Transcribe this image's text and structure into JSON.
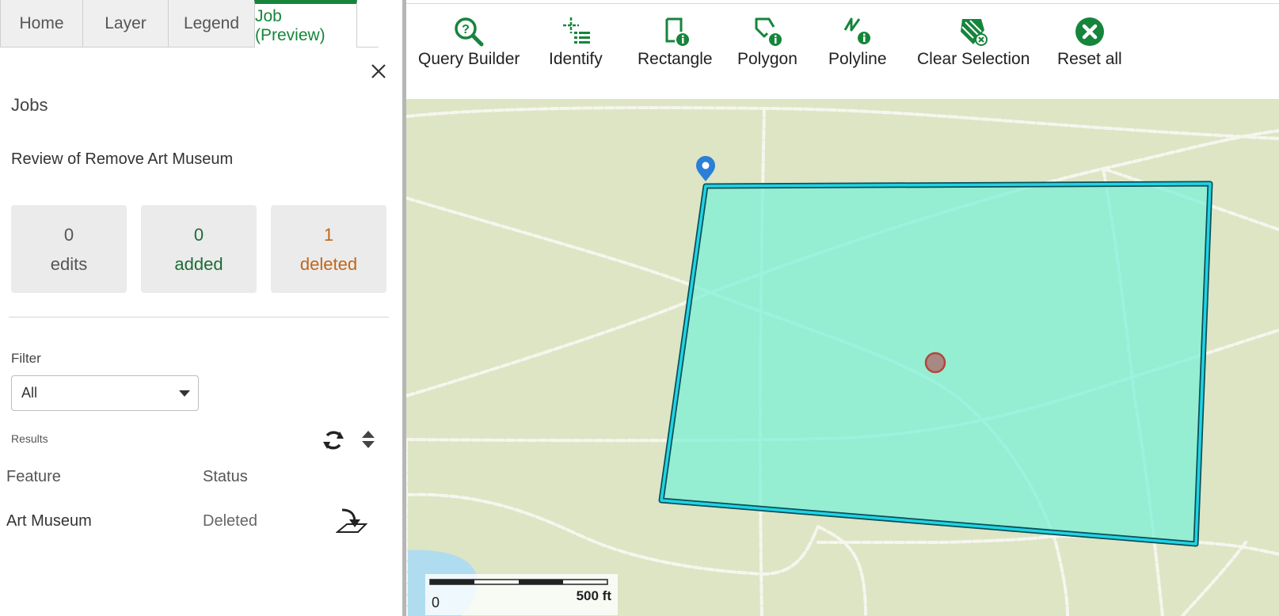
{
  "tabs": [
    {
      "label": "Home",
      "active": false
    },
    {
      "label": "Layer",
      "active": false
    },
    {
      "label": "Legend",
      "active": false
    },
    {
      "label": "Job (Preview)",
      "active": true
    }
  ],
  "panel": {
    "title": "Jobs",
    "job_title": "Review of Remove Art Museum",
    "stats": {
      "edits": {
        "value": "0",
        "label": "edits"
      },
      "added": {
        "value": "0",
        "label": "added"
      },
      "deleted": {
        "value": "1",
        "label": "deleted"
      }
    },
    "filter": {
      "label": "Filter",
      "value": "All"
    },
    "results": {
      "label": "Results",
      "columns": [
        "Feature",
        "Status"
      ],
      "rows": [
        {
          "feature": "Art Museum",
          "status": "Deleted"
        }
      ]
    }
  },
  "toolbar": {
    "items": [
      {
        "label": "Query Builder",
        "icon": "query-builder-icon"
      },
      {
        "label": "Identify",
        "icon": "identify-icon"
      },
      {
        "label": "Rectangle",
        "icon": "rectangle-select-icon"
      },
      {
        "label": "Polygon",
        "icon": "polygon-select-icon"
      },
      {
        "label": "Polyline",
        "icon": "polyline-select-icon"
      },
      {
        "label": "Clear Selection",
        "icon": "clear-selection-icon"
      },
      {
        "label": "Reset all",
        "icon": "reset-all-icon"
      }
    ]
  },
  "map": {
    "scale": {
      "zero": "0",
      "max": "500 ft"
    }
  },
  "colors": {
    "accent": "#15853b",
    "added": "#1e6b34",
    "deleted": "#c0661a",
    "selection_fill": "#8ff0d8",
    "selection_stroke": "#17c7d6",
    "map_background": "#dde5c5",
    "water": "#b0dcf0"
  }
}
